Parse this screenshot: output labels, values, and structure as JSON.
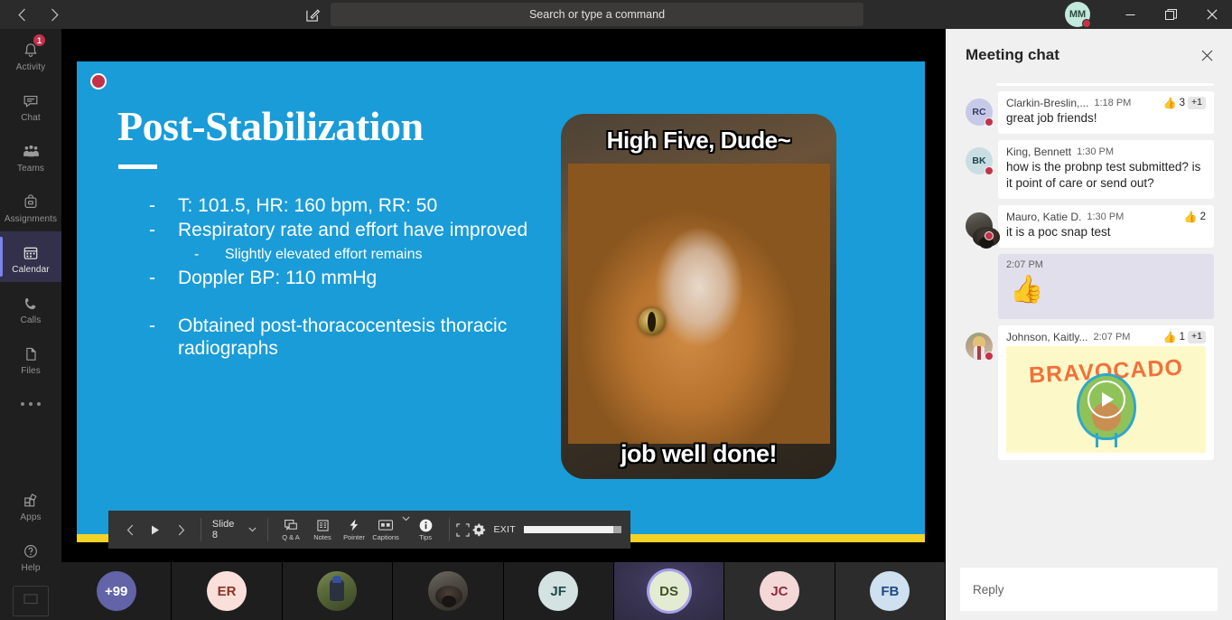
{
  "titlebar": {
    "back_icon": "chevron-left-icon",
    "forward_icon": "chevron-right-icon",
    "compose_icon": "compose-icon",
    "search_placeholder": "Search or type a command",
    "avatar_initials": "MM",
    "minimize_label": "—",
    "maximize_label": "❐",
    "close_label": "✕"
  },
  "rail": {
    "items": [
      {
        "label": "Activity",
        "icon": "bell-icon",
        "badge": "1",
        "active": false
      },
      {
        "label": "Chat",
        "icon": "chat-icon",
        "badge": "",
        "active": false
      },
      {
        "label": "Teams",
        "icon": "teams-icon",
        "badge": "",
        "active": false
      },
      {
        "label": "Assignments",
        "icon": "assignments-icon",
        "badge": "",
        "active": false
      },
      {
        "label": "Calendar",
        "icon": "calendar-icon",
        "badge": "",
        "active": true
      },
      {
        "label": "Calls",
        "icon": "phone-icon",
        "badge": "",
        "active": false
      },
      {
        "label": "Files",
        "icon": "files-icon",
        "badge": "",
        "active": false
      }
    ],
    "more_icon": "more-horizontal-icon",
    "bottom": [
      {
        "label": "Apps",
        "icon": "apps-icon"
      },
      {
        "label": "Help",
        "icon": "help-icon"
      }
    ],
    "store_icon": "store-icon"
  },
  "slide": {
    "recording_indicator": "recording-dot-icon",
    "title": "Post-Stabilization",
    "bullets": [
      {
        "dash": "-",
        "text": "T: 101.5, HR: 160 bpm, RR: 50",
        "level": 1
      },
      {
        "dash": "-",
        "text": "Respiratory rate and effort have improved",
        "level": 1
      },
      {
        "dash": "-",
        "text": "Slightly elevated effort remains",
        "level": 2
      },
      {
        "dash": "-",
        "text": "Doppler BP: 110 mmHg",
        "level": 1
      },
      {
        "dash": "-",
        "text": "Obtained post-thoracocentesis thoracic radiographs",
        "level": 1
      }
    ],
    "meme_top_text": "High Five, Dude~",
    "meme_bottom_text": "job well done!",
    "accent_color": "#1a9cd8",
    "footer_bar_color": "#f5d226"
  },
  "controlbar": {
    "prev_icon": "chevron-left-icon",
    "play_icon": "play-icon",
    "next_icon": "chevron-right-icon",
    "slide_label": "Slide 8",
    "slide_chevron": "chevron-down-icon",
    "tools": [
      {
        "label": "Q & A",
        "icon": "qa-icon"
      },
      {
        "label": "Notes",
        "icon": "notes-icon"
      },
      {
        "label": "Pointer",
        "icon": "pointer-icon"
      },
      {
        "label": "Captions",
        "icon": "captions-icon"
      },
      {
        "label": "Tips",
        "icon": "info-icon"
      }
    ],
    "captions_chevron": "chevron-down-icon",
    "fit_icon": "fit-to-screen-icon",
    "settings_icon": "gear-icon",
    "exit_label": "EXIT",
    "progress_percent": 92
  },
  "filmstrip": {
    "tiles": [
      {
        "type": "overflow",
        "initials": "+99",
        "bg": "#6264a7",
        "fg": "#ffffff",
        "active": false
      },
      {
        "type": "initials",
        "initials": "ER",
        "bg": "#fbdfdb",
        "fg": "#8a3423",
        "active": false
      },
      {
        "type": "photo-hiker",
        "initials": "",
        "bg": "",
        "fg": "",
        "active": false
      },
      {
        "type": "photo-dog",
        "initials": "",
        "bg": "",
        "fg": "",
        "active": false
      },
      {
        "type": "initials",
        "initials": "JF",
        "bg": "#d5e2e2",
        "fg": "#1f4a4a",
        "active": false
      },
      {
        "type": "initials",
        "initials": "DS",
        "bg": "#e3ecd2",
        "fg": "#3f5228",
        "active": true
      },
      {
        "type": "initials",
        "initials": "JC",
        "bg": "#f4d8d8",
        "fg": "#8f2b3c",
        "active": false
      },
      {
        "type": "initials",
        "initials": "FB",
        "bg": "#cfe0f0",
        "fg": "#1f4a82",
        "active": false
      }
    ]
  },
  "chat": {
    "title": "Meeting chat",
    "close_icon": "close-icon",
    "reply_placeholder": "Reply",
    "messages": [
      {
        "kind": "text",
        "self": false,
        "avatar_type": "initials",
        "initials": "RC",
        "avatar_bg": "#c6c9e8",
        "avatar_fg": "#39395f",
        "name": "Clarkin-Breslin,...",
        "time": "1:18 PM",
        "text": "great job friends!",
        "reaction_emoji": "👍",
        "reaction_count": "3",
        "reaction_plus": "+1"
      },
      {
        "kind": "text",
        "self": false,
        "avatar_type": "initials",
        "initials": "BK",
        "avatar_bg": "#c9dde3",
        "avatar_fg": "#1f4550",
        "name": "King, Bennett",
        "time": "1:30 PM",
        "text": "how is the probnp test submitted? is it point of care or send out?",
        "reaction_emoji": "",
        "reaction_count": "",
        "reaction_plus": ""
      },
      {
        "kind": "text",
        "self": false,
        "avatar_type": "photo-dog",
        "initials": "",
        "avatar_bg": "",
        "avatar_fg": "",
        "name": "Mauro, Katie D.",
        "time": "1:30 PM",
        "text": "it is a poc snap test",
        "reaction_emoji": "👍",
        "reaction_count": "2",
        "reaction_plus": ""
      },
      {
        "kind": "emoji",
        "self": true,
        "avatar_type": "none",
        "initials": "",
        "avatar_bg": "",
        "avatar_fg": "",
        "name": "",
        "time": "2:07 PM",
        "text": "👍",
        "reaction_emoji": "",
        "reaction_count": "",
        "reaction_plus": ""
      },
      {
        "kind": "sticker",
        "self": false,
        "avatar_type": "photo-person",
        "initials": "",
        "avatar_bg": "",
        "avatar_fg": "",
        "name": "Johnson, Kaitly...",
        "time": "2:07 PM",
        "text": "",
        "sticker_word": "BRAVOCADO",
        "reaction_emoji": "👍",
        "reaction_count": "1",
        "reaction_plus": "+1"
      }
    ]
  }
}
